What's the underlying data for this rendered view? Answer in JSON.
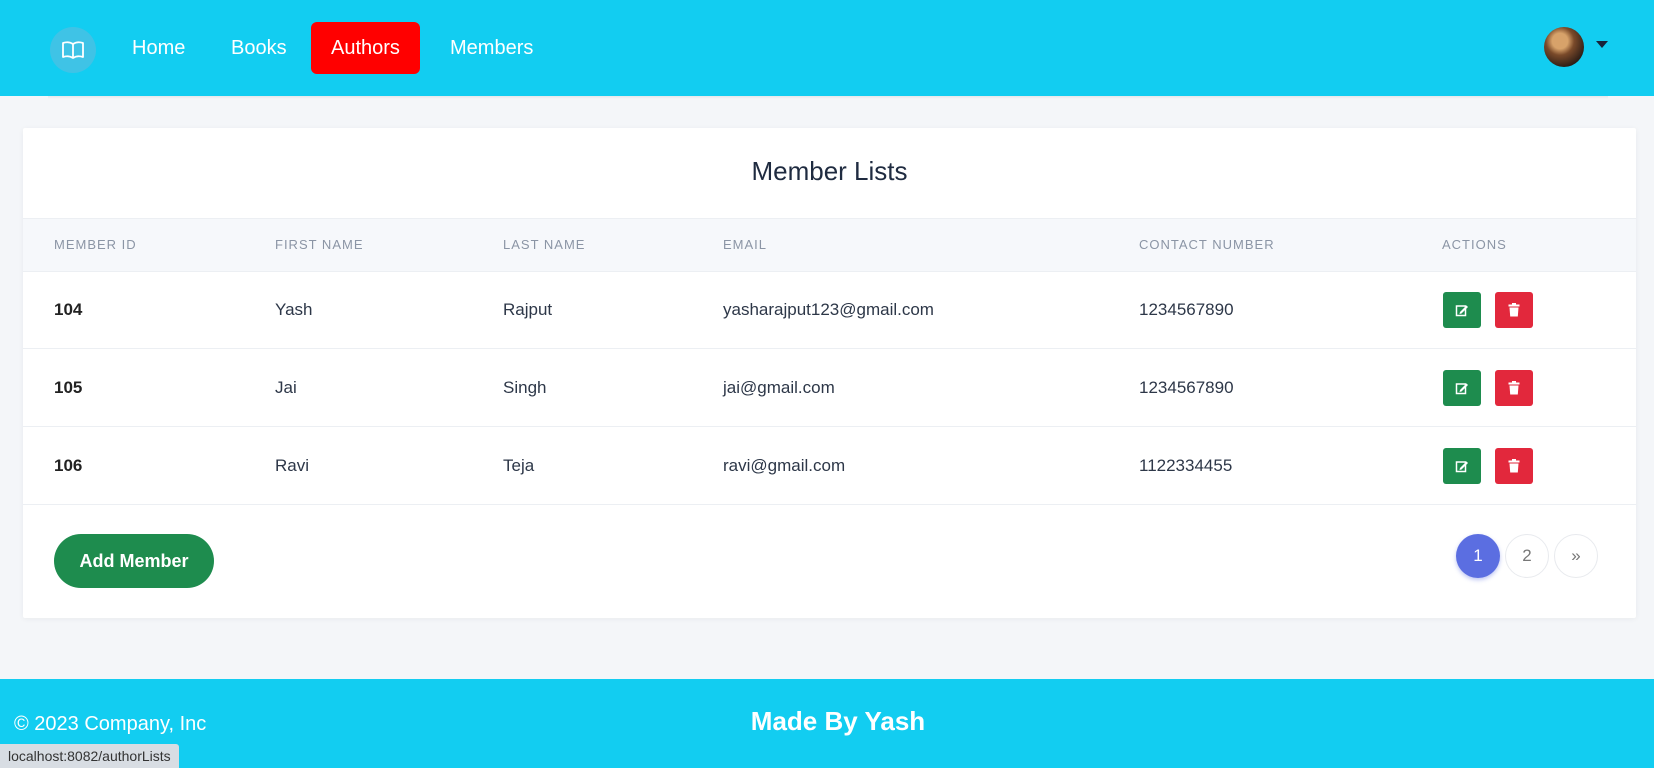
{
  "nav": {
    "logo_icon": "open-book-icon",
    "links": [
      "Home",
      "Books",
      "Authors",
      "Members"
    ],
    "active": "Authors",
    "active_color": "#ff0000",
    "bar_color": "#12cdf1"
  },
  "card": {
    "title": "Member Lists",
    "columns": [
      "MEMBER ID",
      "FIRST NAME",
      "LAST NAME",
      "EMAIL",
      "CONTACT NUMBER",
      "ACTIONS"
    ],
    "rows": [
      {
        "id": "104",
        "first": "Yash",
        "last": "Rajput",
        "email": "yasharajput123@gmail.com",
        "contact": "1234567890"
      },
      {
        "id": "105",
        "first": "Jai",
        "last": "Singh",
        "email": "jai@gmail.com",
        "contact": "1234567890"
      },
      {
        "id": "106",
        "first": "Ravi",
        "last": "Teja",
        "email": "ravi@gmail.com",
        "contact": "1122334455"
      }
    ],
    "edit_icon": "edit-icon",
    "delete_icon": "trash-icon",
    "add_label": "Add Member",
    "pagination": [
      "1",
      "2",
      "»"
    ],
    "current_page": "1"
  },
  "footer": {
    "copyright": "© 2023 Company, Inc",
    "made_by": "Made By Yash"
  },
  "status_url": "localhost:8082/authorLists"
}
